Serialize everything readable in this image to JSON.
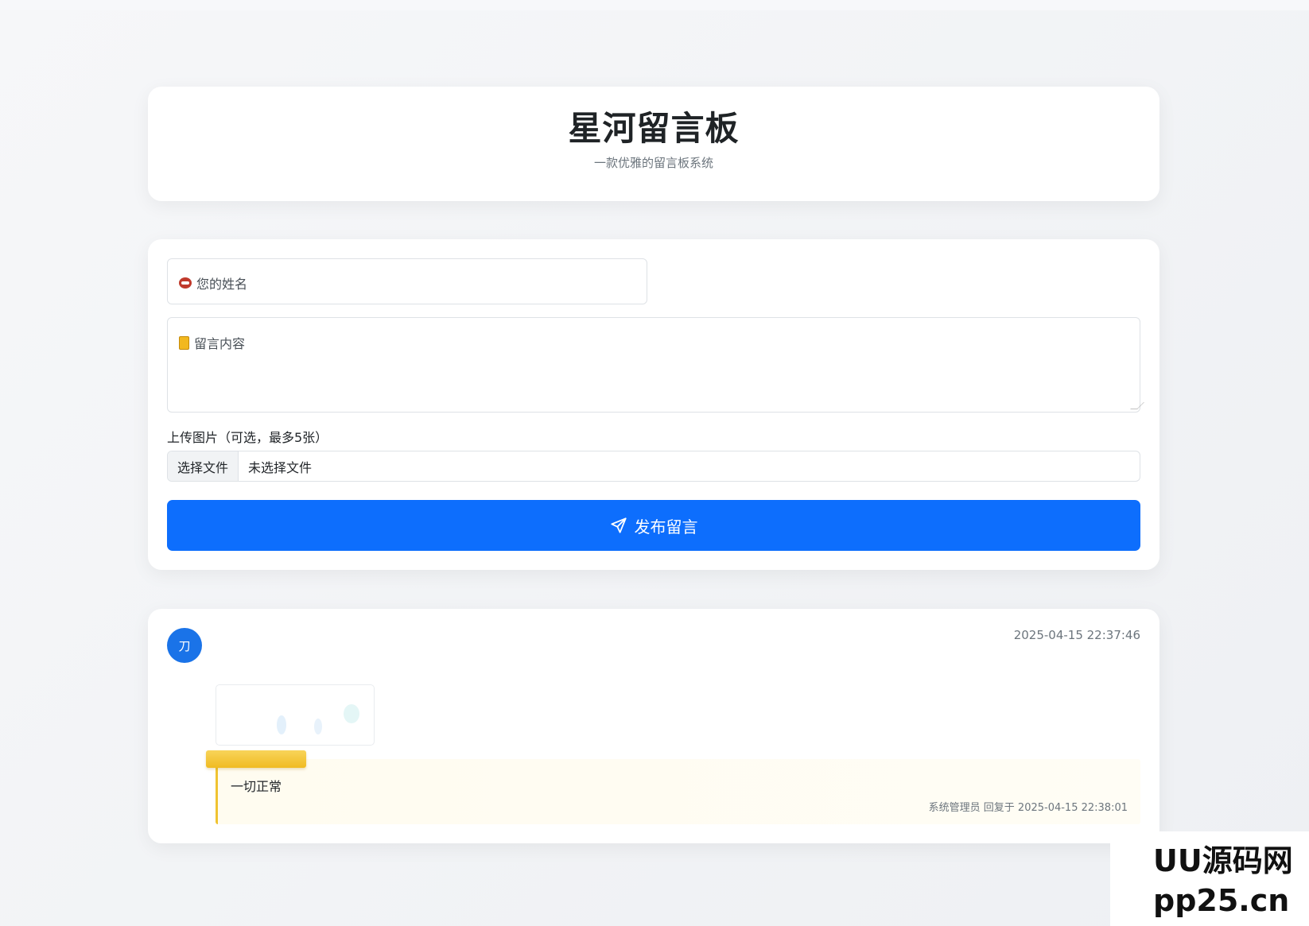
{
  "header": {
    "title": "星河留言板",
    "subtitle": "一款优雅的留言板系统"
  },
  "form": {
    "name_placeholder": "您的姓名",
    "content_placeholder": "留言内容",
    "upload_label": "上传图片（可选，最多5张）",
    "file_button": "选择文件",
    "file_status": "未选择文件",
    "submit_label": "发布留言",
    "name_icon": "mouth-emoji-icon",
    "content_icon": "notebook-emoji-icon",
    "submit_icon": "send-icon"
  },
  "messages": [
    {
      "avatar_initial": "刀",
      "timestamp": "2025-04-15 22:37:46",
      "reply": {
        "text": "一切正常",
        "meta": "系统管理员 回复于 2025-04-15 22:38:01"
      }
    }
  ],
  "watermark": {
    "line1": "UU源码网",
    "line2": "pp25.cn"
  },
  "colors": {
    "primary": "#0d6efd",
    "avatar": "#1a73e8",
    "reply_accent": "#f0c330",
    "reply_bg": "#fffcf0"
  }
}
